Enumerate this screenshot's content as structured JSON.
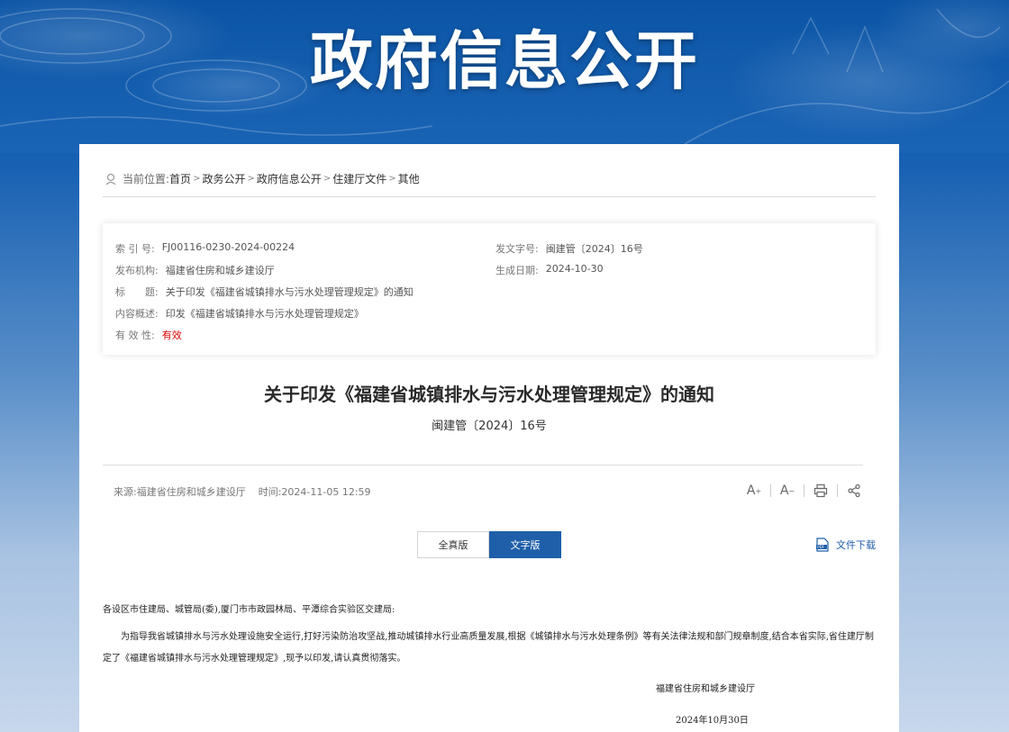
{
  "banner": {
    "title": "政府信息公开"
  },
  "breadcrumb": {
    "label": "当前位置:",
    "items": [
      "首页",
      "政务公开",
      "政府信息公开",
      "住建厅文件",
      "其他"
    ],
    "separator": ">"
  },
  "meta": {
    "index_key": "索 引 号:",
    "index_val": "FJ00116-0230-2024-00224",
    "docno_key": "发文字号:",
    "docno_val": "闽建管〔2024〕16号",
    "publisher_key": "发布机构:",
    "publisher_val": "福建省住房和城乡建设厅",
    "date_key": "生成日期:",
    "date_val": "2024-10-30",
    "title_key": "标　　题:",
    "title_val": "关于印发《福建省城镇排水与污水处理管理规定》的通知",
    "summary_key": "内容概述:",
    "summary_val": "印发《福建省城镇排水与污水处理管理规定》",
    "validity_key": "有 效 性:",
    "validity_val": "有效",
    "validity_color": "#d60000"
  },
  "article": {
    "title": "关于印发《福建省城镇排水与污水处理管理规定》的通知",
    "docno": "闽建管〔2024〕16号",
    "source": "来源:福建省住房和城乡建设厅",
    "time": "时间:2024-11-05 12:59",
    "tools": [
      "font-increase-icon",
      "font-decrease-icon",
      "print-icon",
      "share-icon"
    ],
    "tabs": [
      "全真版",
      "文字版"
    ],
    "active_tab": "文字版",
    "download_label": "文件下载",
    "salutation": "各设区市住建局、城管局(委),厦门市市政园林局、平潭综合实验区交建局:",
    "paragraph": "为指导我省城镇排水与污水处理设施安全运行,打好污染防治攻坚战,推动城镇排水行业高质量发展,根据《城镇排水与污水处理条例》等有关法律法规和部门规章制度,结合本省实际,省住建厅制定了《福建省城镇排水与污水处理管理规定》,现予以印发,请认真贯彻落实。",
    "signature": "福建省住房和城乡建设厅",
    "sign_date": "2024年10月30日"
  },
  "colors": {
    "accent": "#1f5fa9",
    "banner": "#0c55a6"
  }
}
